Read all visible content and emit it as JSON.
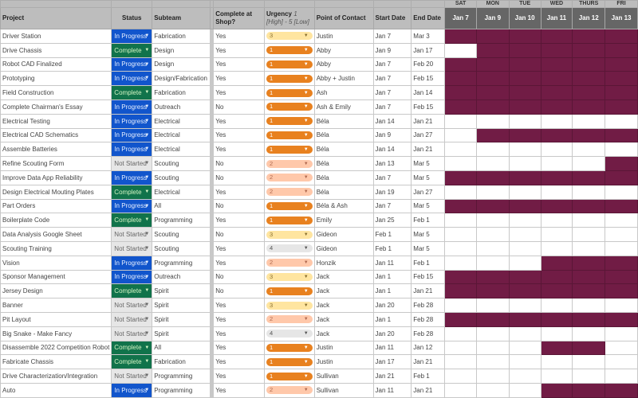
{
  "headers": {
    "project": "Project",
    "status": "Status",
    "subteam": "Subteam",
    "complete": "Complete at Shop?",
    "urgency": "Urgency",
    "urgency_hint": "1 [High] - 5 [Low]",
    "poc": "Point of Contact",
    "start": "Start Date",
    "end": "End Date"
  },
  "days": [
    {
      "dow": "SAT",
      "date": "Jan 7"
    },
    {
      "dow": "MON",
      "date": "Jan 9"
    },
    {
      "dow": "TUE",
      "date": "Jan 10"
    },
    {
      "dow": "WED",
      "date": "Jan 11"
    },
    {
      "dow": "THURS",
      "date": "Jan 12"
    },
    {
      "dow": "FRI",
      "date": "Jan 13"
    }
  ],
  "colors": {
    "in_progress": "#1155cc",
    "complete": "#11734b",
    "not_started": "#e6e6e6",
    "gantt": "#711c45",
    "urgency_1": "#e8811f",
    "urgency_2": "#ffc8aa",
    "urgency_3": "#ffe5a0",
    "urgency_4": "#e6e6e6"
  },
  "rows": [
    {
      "project": "Driver Station",
      "status": "In Progress",
      "subteam": "Fabrication",
      "complete": "Yes",
      "urgency": "3",
      "poc": "Justin",
      "start": "Jan 7",
      "end": "Mar 3",
      "gantt": [
        1,
        1,
        1,
        1,
        1,
        1
      ]
    },
    {
      "project": "Drive Chassis",
      "status": "Complete",
      "subteam": "Design",
      "complete": "Yes",
      "urgency": "1",
      "poc": "Abby",
      "start": "Jan 9",
      "end": "Jan 17",
      "gantt": [
        0,
        1,
        1,
        1,
        1,
        1
      ]
    },
    {
      "project": "Robot CAD Finalized",
      "status": "In Progress",
      "subteam": "Design",
      "complete": "Yes",
      "urgency": "1",
      "poc": "Abby",
      "start": "Jan 7",
      "end": "Feb 20",
      "gantt": [
        1,
        1,
        1,
        1,
        1,
        1
      ]
    },
    {
      "project": "Prototyping",
      "status": "In Progress",
      "subteam": "Design/Fabrication",
      "complete": "Yes",
      "urgency": "1",
      "poc": "Abby + Justin",
      "start": "Jan 7",
      "end": "Feb 15",
      "gantt": [
        1,
        1,
        1,
        1,
        1,
        1
      ]
    },
    {
      "project": "Field Construction",
      "status": "Complete",
      "subteam": "Fabrication",
      "complete": "Yes",
      "urgency": "1",
      "poc": "Ash",
      "start": "Jan 7",
      "end": "Jan 14",
      "gantt": [
        1,
        1,
        1,
        1,
        1,
        1
      ]
    },
    {
      "project": "Complete Chairman's Essay",
      "status": "In Progress",
      "subteam": "Outreach",
      "complete": "No",
      "urgency": "1",
      "poc": "Ash & Emily",
      "start": "Jan 7",
      "end": "Feb 15",
      "gantt": [
        1,
        1,
        1,
        1,
        1,
        1
      ]
    },
    {
      "project": "Electrical Testing",
      "status": "In Progress",
      "subteam": "Electrical",
      "complete": "Yes",
      "urgency": "1",
      "poc": "Béla",
      "start": "Jan 14",
      "end": "Jan 21",
      "gantt": [
        0,
        0,
        0,
        0,
        0,
        0
      ]
    },
    {
      "project": "Electrical CAD Schematics",
      "status": "In Progress",
      "subteam": "Electrical",
      "complete": "Yes",
      "urgency": "1",
      "poc": "Béla",
      "start": "Jan 9",
      "end": "Jan 27",
      "gantt": [
        0,
        1,
        1,
        1,
        1,
        1
      ]
    },
    {
      "project": "Assemble Batteries",
      "status": "In Progress",
      "subteam": "Electrical",
      "complete": "Yes",
      "urgency": "1",
      "poc": "Béla",
      "start": "Jan 14",
      "end": "Jan 21",
      "gantt": [
        0,
        0,
        0,
        0,
        0,
        0
      ]
    },
    {
      "project": "Refine Scouting Form",
      "status": "Not Started",
      "subteam": "Scouting",
      "complete": "No",
      "urgency": "2",
      "poc": "Béla",
      "start": "Jan 13",
      "end": "Mar 5",
      "gantt": [
        0,
        0,
        0,
        0,
        0,
        1
      ]
    },
    {
      "project": "Improve Data App Reliability",
      "status": "In Progress",
      "subteam": "Scouting",
      "complete": "No",
      "urgency": "2",
      "poc": "Béla",
      "start": "Jan 7",
      "end": "Mar 5",
      "gantt": [
        1,
        1,
        1,
        1,
        1,
        1
      ]
    },
    {
      "project": "Design Electrical Mouting Plates",
      "status": "Complete",
      "subteam": "Electrical",
      "complete": "Yes",
      "urgency": "2",
      "poc": "Béla",
      "start": "Jan 19",
      "end": "Jan 27",
      "gantt": [
        0,
        0,
        0,
        0,
        0,
        0
      ]
    },
    {
      "project": "Part Orders",
      "status": "In Progress",
      "subteam": "All",
      "complete": "No",
      "urgency": "1",
      "poc": "Béla & Ash",
      "start": "Jan 7",
      "end": "Mar 5",
      "gantt": [
        1,
        1,
        1,
        1,
        1,
        1
      ]
    },
    {
      "project": "Boilerplate Code",
      "status": "Complete",
      "subteam": "Programming",
      "complete": "Yes",
      "urgency": "1",
      "poc": "Emily",
      "start": "Jan 25",
      "end": "Feb 1",
      "gantt": [
        0,
        0,
        0,
        0,
        0,
        0
      ]
    },
    {
      "project": "Data Analysis Google Sheet",
      "status": "Not Started",
      "subteam": "Scouting",
      "complete": "No",
      "urgency": "3",
      "poc": "Gideon",
      "start": "Feb 1",
      "end": "Mar 5",
      "gantt": [
        0,
        0,
        0,
        0,
        0,
        0
      ]
    },
    {
      "project": "Scouting Training",
      "status": "Not Started",
      "subteam": "Scouting",
      "complete": "Yes",
      "urgency": "4",
      "poc": "Gideon",
      "start": "Feb 1",
      "end": "Mar 5",
      "gantt": [
        0,
        0,
        0,
        0,
        0,
        0
      ]
    },
    {
      "project": "Vision",
      "status": "In Progress",
      "subteam": "Programming",
      "complete": "Yes",
      "urgency": "2",
      "poc": "Honzik",
      "start": "Jan 11",
      "end": "Feb 1",
      "gantt": [
        0,
        0,
        0,
        1,
        1,
        1
      ]
    },
    {
      "project": "Sponsor Management",
      "status": "In Progress",
      "subteam": "Outreach",
      "complete": "No",
      "urgency": "3",
      "poc": "Jack",
      "start": "Jan 1",
      "end": "Feb 15",
      "gantt": [
        1,
        1,
        1,
        1,
        1,
        1
      ]
    },
    {
      "project": "Jersey Design",
      "status": "Complete",
      "subteam": "Spirit",
      "complete": "No",
      "urgency": "1",
      "poc": "Jack",
      "start": "Jan 1",
      "end": "Jan 21",
      "gantt": [
        1,
        1,
        1,
        1,
        1,
        1
      ]
    },
    {
      "project": "Banner",
      "status": "Not Started",
      "subteam": "Spirit",
      "complete": "Yes",
      "urgency": "3",
      "poc": "Jack",
      "start": "Jan 20",
      "end": "Feb 28",
      "gantt": [
        0,
        0,
        0,
        0,
        0,
        0
      ]
    },
    {
      "project": "Pit Layout",
      "status": "Not Started",
      "subteam": "Spirit",
      "complete": "Yes",
      "urgency": "2",
      "poc": "Jack",
      "start": "Jan 1",
      "end": "Feb 28",
      "gantt": [
        1,
        1,
        1,
        1,
        1,
        1
      ]
    },
    {
      "project": "Big Snake - Make Fancy",
      "status": "Not Started",
      "subteam": "Spirit",
      "complete": "Yes",
      "urgency": "4",
      "poc": "Jack",
      "start": "Jan 20",
      "end": "Feb 28",
      "gantt": [
        0,
        0,
        0,
        0,
        0,
        0
      ]
    },
    {
      "project": "Disassemble 2022 Competition Robot",
      "status": "Complete",
      "subteam": "All",
      "complete": "Yes",
      "urgency": "1",
      "poc": "Justin",
      "start": "Jan 11",
      "end": "Jan 12",
      "gantt": [
        0,
        0,
        0,
        1,
        1,
        0
      ]
    },
    {
      "project": "Fabricate Chassis",
      "status": "Complete",
      "subteam": "Fabrication",
      "complete": "Yes",
      "urgency": "1",
      "poc": "Justin",
      "start": "Jan 17",
      "end": "Jan 21",
      "gantt": [
        0,
        0,
        0,
        0,
        0,
        0
      ]
    },
    {
      "project": "Drive Characterization/Integration",
      "status": "Not Started",
      "subteam": "Programming",
      "complete": "Yes",
      "urgency": "1",
      "poc": "Sullivan",
      "start": "Jan 21",
      "end": "Feb 1",
      "gantt": [
        0,
        0,
        0,
        0,
        0,
        0
      ]
    },
    {
      "project": "Auto",
      "status": "In Progress",
      "subteam": "Programming",
      "complete": "Yes",
      "urgency": "2",
      "poc": "Sullivan",
      "start": "Jan 11",
      "end": "Jan 21",
      "gantt": [
        0,
        0,
        0,
        1,
        1,
        1
      ]
    }
  ]
}
